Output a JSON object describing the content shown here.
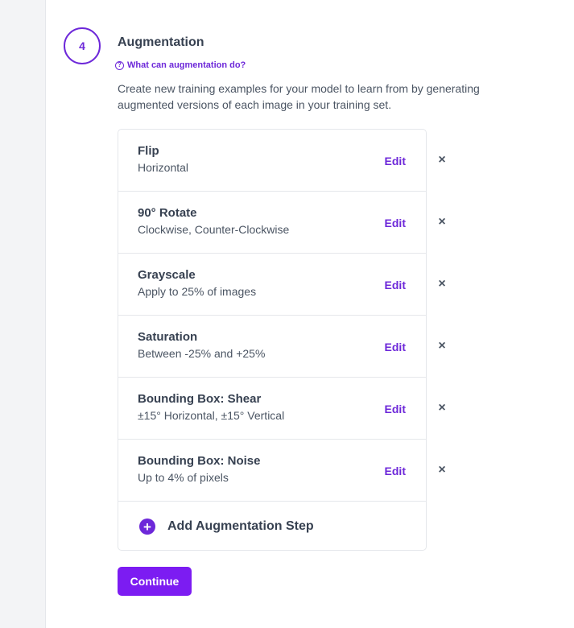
{
  "step": {
    "number": "4",
    "title": "Augmentation",
    "help_link": "What can augmentation do?",
    "description": "Create new training examples for your model to learn from by generating augmented versions of each image in your training set."
  },
  "augmentations": [
    {
      "title": "Flip",
      "detail": "Horizontal",
      "edit_label": "Edit",
      "remove_label": "×"
    },
    {
      "title": "90° Rotate",
      "detail": "Clockwise, Counter-Clockwise",
      "edit_label": "Edit",
      "remove_label": "×"
    },
    {
      "title": "Grayscale",
      "detail": "Apply to 25% of images",
      "edit_label": "Edit",
      "remove_label": "×"
    },
    {
      "title": "Saturation",
      "detail": "Between -25% and +25%",
      "edit_label": "Edit",
      "remove_label": "×"
    },
    {
      "title": "Bounding Box: Shear",
      "detail": "±15° Horizontal, ±15° Vertical",
      "edit_label": "Edit",
      "remove_label": "×"
    },
    {
      "title": "Bounding Box: Noise",
      "detail": "Up to 4% of pixels",
      "edit_label": "Edit",
      "remove_label": "×"
    }
  ],
  "add_step": {
    "label": "Add Augmentation Step",
    "icon": "plus-circle-icon"
  },
  "continue_label": "Continue",
  "colors": {
    "accent": "#6d28d9",
    "button": "#7c1cf2",
    "text": "#374151",
    "muted": "#4b5563"
  },
  "icons": {
    "help": "question-circle-icon",
    "remove": "close-icon",
    "add": "plus-circle-icon"
  }
}
